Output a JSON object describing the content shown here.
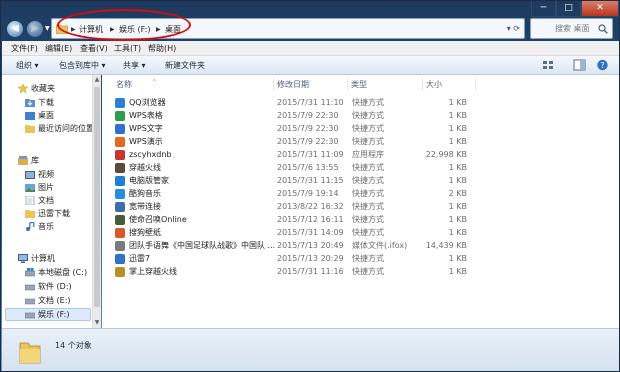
{
  "window": {
    "minimize_glyph": "─",
    "maximize_glyph": "□",
    "close_glyph": "✕"
  },
  "nav": {
    "back_glyph": "◀",
    "forward_glyph": "▶",
    "dropdown_glyph": "▼"
  },
  "address": {
    "crumbs": [
      "计算机",
      "娱乐 (F:)",
      "桌面"
    ],
    "separator": "▶",
    "controls": "▾ ⟳"
  },
  "search": {
    "placeholder": "搜索 桌面"
  },
  "menubar": {
    "file": "文件(F)",
    "edit": "编辑(E)",
    "view": "查看(V)",
    "tools": "工具(T)",
    "help": "帮助(H)"
  },
  "toolbar": {
    "organize": "组织 ▾",
    "include_in_library": "包含到库中 ▾",
    "share": "共享 ▾",
    "new_folder": "新建文件夹"
  },
  "sidebar": {
    "favorites": {
      "label": "收藏夹",
      "items": [
        "下载",
        "桌面",
        "最近访问的位置"
      ]
    },
    "libraries": {
      "label": "库",
      "items": [
        "视频",
        "图片",
        "文档",
        "迅雷下载",
        "音乐"
      ]
    },
    "computer": {
      "label": "计算机",
      "items": [
        "本地磁盘 (C:)",
        "软件 (D:)",
        "文档 (E:)",
        "娱乐 (F:)"
      ]
    }
  },
  "columns": {
    "name": "名称",
    "date": "修改日期",
    "type": "类型",
    "size": "大小",
    "sort_arrow": "^"
  },
  "files": [
    {
      "name": "QQ浏览器",
      "date": "2015/7/31 11:10",
      "type": "快捷方式",
      "size": "1 KB",
      "icon_color": "#2e7fd6"
    },
    {
      "name": "WPS表格",
      "date": "2015/7/9 22:30",
      "type": "快捷方式",
      "size": "1 KB",
      "icon_color": "#2f9d4c"
    },
    {
      "name": "WPS文字",
      "date": "2015/7/9 22:30",
      "type": "快捷方式",
      "size": "1 KB",
      "icon_color": "#2f6fce"
    },
    {
      "name": "WPS演示",
      "date": "2015/7/9 22:30",
      "type": "快捷方式",
      "size": "1 KB",
      "icon_color": "#e06a1f"
    },
    {
      "name": "zscyhxdnb",
      "date": "2015/7/31 11:09",
      "type": "应用程序",
      "size": "22,998 KB",
      "icon_color": "#c8352e"
    },
    {
      "name": "穿越火线",
      "date": "2015/7/6 13:55",
      "type": "快捷方式",
      "size": "1 KB",
      "icon_color": "#5a4a3a"
    },
    {
      "name": "电脑版管家",
      "date": "2015/7/31 11:15",
      "type": "快捷方式",
      "size": "1 KB",
      "icon_color": "#1f7fd0"
    },
    {
      "name": "酷狗音乐",
      "date": "2015/7/9 19:14",
      "type": "快捷方式",
      "size": "2 KB",
      "icon_color": "#2a8ee0"
    },
    {
      "name": "宽带连接",
      "date": "2013/8/22 16:32",
      "type": "快捷方式",
      "size": "1 KB",
      "icon_color": "#3b6ea8"
    },
    {
      "name": "使命召唤Online",
      "date": "2015/7/12 16:11",
      "type": "快捷方式",
      "size": "1 KB",
      "icon_color": "#4a5b3c"
    },
    {
      "name": "搜狗壁纸",
      "date": "2015/7/31 14:09",
      "type": "快捷方式",
      "size": "1 KB",
      "icon_color": "#d65a2a"
    },
    {
      "name": "团队手语舞《中国足球队战歌》中国队 ...",
      "date": "2015/7/13 20:49",
      "type": "媒体文件(.ifox)",
      "size": "14,439 KB",
      "icon_color": "#7a7a7a"
    },
    {
      "name": "迅雷7",
      "date": "2015/7/13 20:29",
      "type": "快捷方式",
      "size": "1 KB",
      "icon_color": "#2c74c9"
    },
    {
      "name": "掌上穿越火线",
      "date": "2015/7/31 11:16",
      "type": "快捷方式",
      "size": "1 KB",
      "icon_color": "#b8902a"
    }
  ],
  "status": {
    "count": "14 个对象"
  }
}
